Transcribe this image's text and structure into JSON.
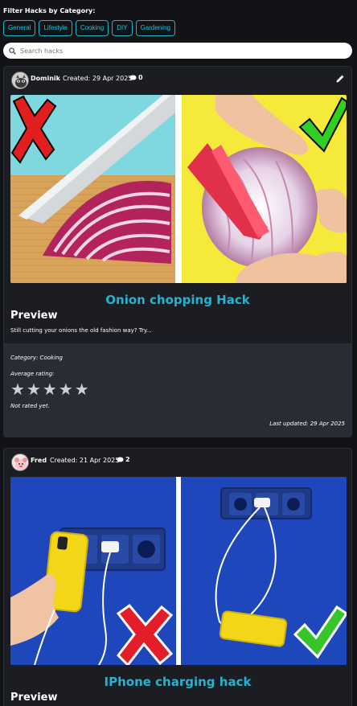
{
  "filter": {
    "title": "Filter Hacks by Category:",
    "categories": [
      "General",
      "Lifestyle",
      "Cooking",
      "DIY",
      "Gardening"
    ]
  },
  "search": {
    "placeholder": "Search hacks"
  },
  "hacks": [
    {
      "author": "Dominik",
      "created": "Created: 29 Apr 2025",
      "comments": "0",
      "title": "Onion chopping Hack",
      "preview_heading": "Preview",
      "preview_text": "Still cutting your onions the old fashion way? Try...",
      "category": "Category: Cooking",
      "rating_label": "Average rating:",
      "rating_status": "Not rated yet.",
      "updated": "Last updated: 29 Apr 2025",
      "image_icons": [
        "red-x-icon",
        "green-check-icon"
      ]
    },
    {
      "author": "Fred",
      "created": "Created: 21 Apr 2025",
      "comments": "2",
      "title": "IPhone charging hack",
      "preview_heading": "Preview",
      "image_icons": [
        "red-x-icon",
        "green-check-icon"
      ]
    }
  ],
  "colors": {
    "accent": "#21c5da",
    "background": "#111317",
    "card": "#1b1d22",
    "meta": "#2a2c35"
  }
}
